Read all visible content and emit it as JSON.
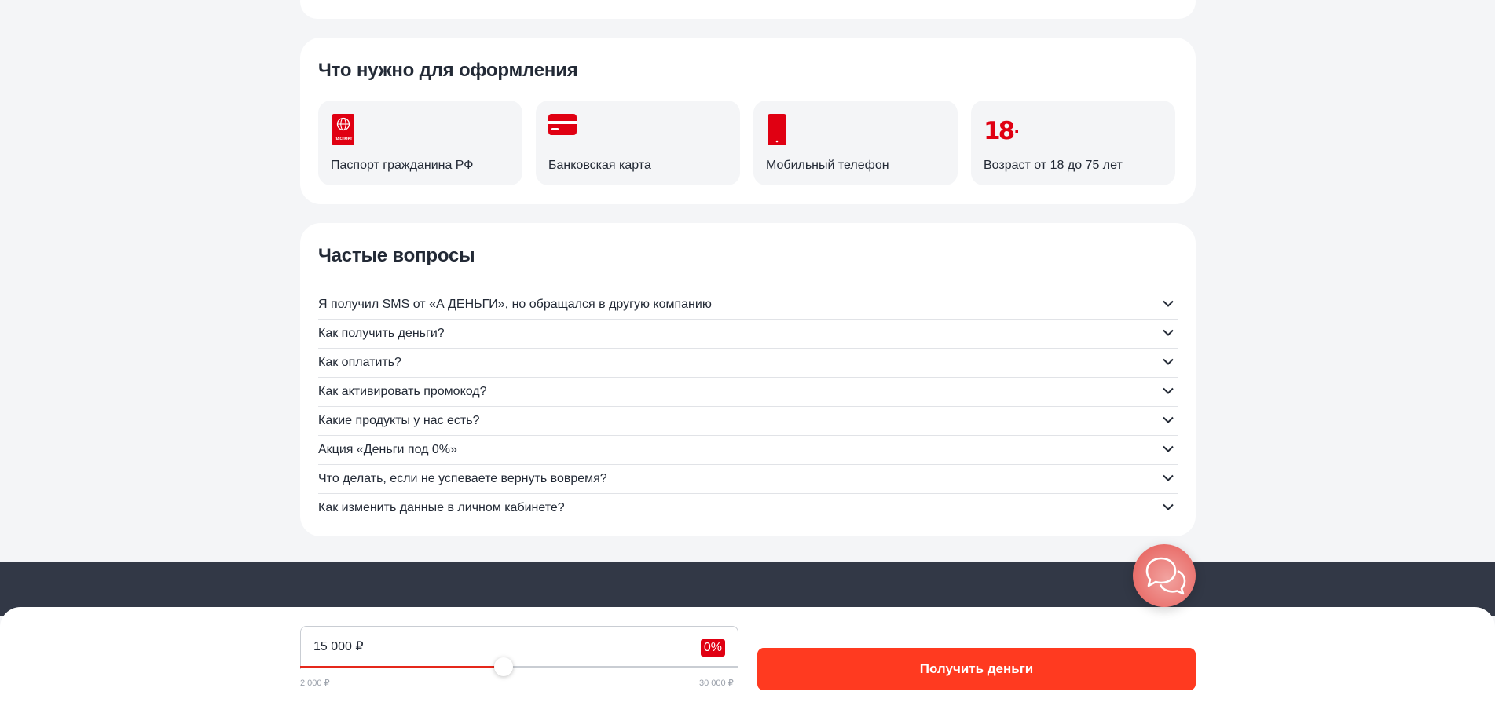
{
  "requirements": {
    "title": "Что нужно для оформления",
    "items": [
      {
        "icon": "passport-icon",
        "label": "Паспорт гражданина РФ",
        "icon_text": "ПАСПОРТ"
      },
      {
        "icon": "bank-card-icon",
        "label": "Банковская карта"
      },
      {
        "icon": "mobile-phone-icon",
        "label": "Мобильный телефон"
      },
      {
        "icon": "age-18-plus-icon",
        "label": "Возраст от 18 до 75 лет",
        "icon_text": "18+"
      }
    ]
  },
  "faq": {
    "title": "Частые вопросы",
    "items": [
      "Я получил SMS от «А ДЕНЬГИ», но обращался в другую компанию",
      "Как получить деньги?",
      "Как оплатить?",
      "Как активировать промокод?",
      "Какие продукты у нас есть?",
      "Акция «Деньги под 0%»",
      "Что делать, если не успеваете вернуть вовремя?",
      "Как изменить данные в личном кабинете?"
    ]
  },
  "loan": {
    "amount_value": "15 000 ₽",
    "rate_badge": "0%",
    "slider_min": "2 000 ₽",
    "slider_max": "30 000 ₽",
    "slider_min_value": 2000,
    "slider_max_value": 30000,
    "slider_value": 15000,
    "cta_label": "Получить деньги"
  },
  "colors": {
    "brand_red": "#e00012",
    "cta": "#ff3a20",
    "dark_band": "#323846",
    "page_bg": "#f4f5f7"
  }
}
